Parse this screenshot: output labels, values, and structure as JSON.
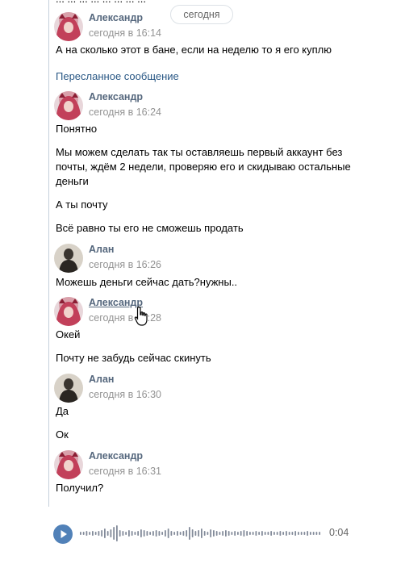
{
  "top_fragment": "... ... ... ... ... ... ... ...",
  "date_divider": "сегодня",
  "forwarded_label": "Пересланное сообщение",
  "groups": [
    {
      "author": "Александр",
      "time": "сегодня в 16:14",
      "avatar": "alexandr-avatar",
      "messages": [
        "А на сколько этот в бане, если на неделю то я его куплю"
      ]
    },
    {
      "author": "Александр",
      "time": "сегодня в 16:24",
      "avatar": "alexandr-avatar",
      "messages": [
        "Понятно",
        "Мы можем сделать так ты оставляешь первый аккаунт без",
        "почты, ждём 2 недели, проверяю его и скидываю остальные",
        "деньги",
        "А ты почту",
        "Всё равно ты его не сможешь продать"
      ]
    },
    {
      "author": "Алан",
      "time": "сегодня в 16:26",
      "avatar": "alan-avatar",
      "messages": [
        "Можешь деньги сейчас дать?нужны.."
      ]
    },
    {
      "author": "Александр",
      "time": "сегодня в 16:28",
      "avatar": "alexandr-avatar",
      "messages": [
        "Окей",
        "Почту не забудь сейчас скинуть"
      ]
    },
    {
      "author": "Алан",
      "time": "сегодня в 16:30",
      "avatar": "alan-avatar",
      "messages": [
        "Да",
        "Ок"
      ]
    },
    {
      "author": "Александр",
      "time": "сегодня в 16:31",
      "avatar": "alexandr-avatar",
      "messages": [
        "Получил?"
      ]
    }
  ],
  "voice": {
    "duration": "0:04",
    "play_icon": "play-icon",
    "accent": "#5181b8"
  },
  "colors": {
    "author": "#55677d",
    "time": "#939393",
    "link": "#2a5885",
    "line": "#c5d0db"
  }
}
